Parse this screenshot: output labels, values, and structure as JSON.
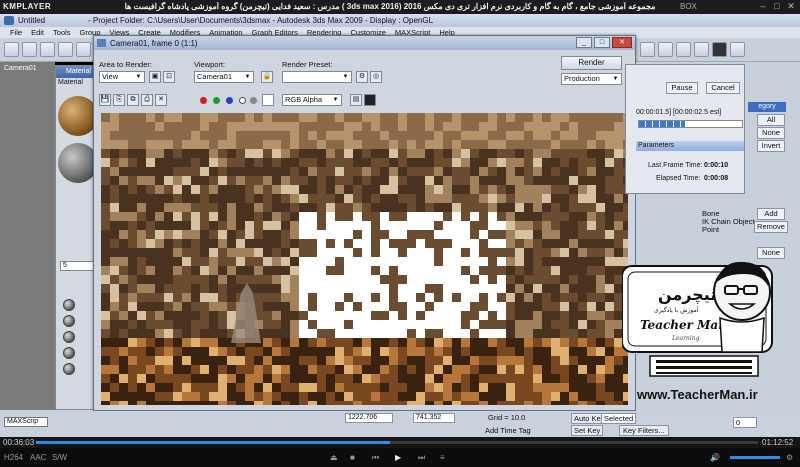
{
  "kmplayer": {
    "logo": "KMPLAYER",
    "title": "مجموعه آموزشی جامع ، گام به گام و کاربردی نرم افزار تری دی مکس 2016 (3ds max 2016 ) مدرس : سعید فدایی (تیچرمن) گروه آموزشی پادشاه گرافیست ها",
    "box": "BOX",
    "time_current": "00:36:03",
    "time_total": "01:12:52",
    "progress": 0.49,
    "codecs": [
      "H264",
      "AAC",
      "S/W"
    ]
  },
  "max": {
    "untitled": "Untitled",
    "title_path": "- Project Folder: C:\\Users\\User\\Documents\\3dsmax   - Autodesk 3ds Max  2009      - Display : OpenGL",
    "menu": [
      "File",
      "Edit",
      "Tools",
      "Group",
      "Views",
      "Create",
      "Modifiers",
      "Animation",
      "Graph Editors",
      "Rendering",
      "Customize",
      "MAXScript",
      "Help"
    ],
    "viewport_label": "Camera01",
    "maxscript": "MAXScrip"
  },
  "mat_editor": {
    "title": "Material E",
    "menu": "Material",
    "spinner_value": "5"
  },
  "render_win": {
    "title": "Camera01, frame 0 (1:1)",
    "area_label": "Area to Render:",
    "area_value": "View",
    "viewport_label": "Viewport:",
    "viewport_value": "Camera01",
    "preset_label": "Render Preset:",
    "preset_value": "",
    "render_button": "Render",
    "production_value": "Production",
    "channel_value": "RGB Alpha",
    "colors": [
      "#d02020",
      "#1f9a2a",
      "#2440c8"
    ]
  },
  "progress": {
    "pause": "Pause",
    "cancel": "Cancel",
    "time_est": "00:00:01.5] [00:00:02.5 est]",
    "params": "Parameters",
    "last_frame_label": "Last Frame Time:",
    "last_frame_value": "0:00:10",
    "elapsed_label": "Elapsed Time:",
    "elapsed_value": "0:00:08",
    "fill": 0.45
  },
  "right": {
    "category": "egory",
    "all": "All",
    "none": "None",
    "invert": "Invert",
    "list": [
      "Bone",
      "IK Chain Object",
      "Point"
    ],
    "add": "Add",
    "remove": "Remove",
    "none2": "None"
  },
  "status": {
    "coord_x": "1222.706",
    "coord_y": "741.352",
    "grid": "Grid = 10.0",
    "auto_key": "Auto Key",
    "selected": "Selected",
    "set_key": "Set Key",
    "key_filters": "Key Filters...",
    "add_time_tag": "Add Time Tag",
    "frame": "0"
  },
  "logo": {
    "brand_fa": "تیچرمن",
    "sub_fa": "آموزش با یادگیری",
    "brand_en": "Teacher Man",
    "url": "www.TeacherMan.ir"
  }
}
